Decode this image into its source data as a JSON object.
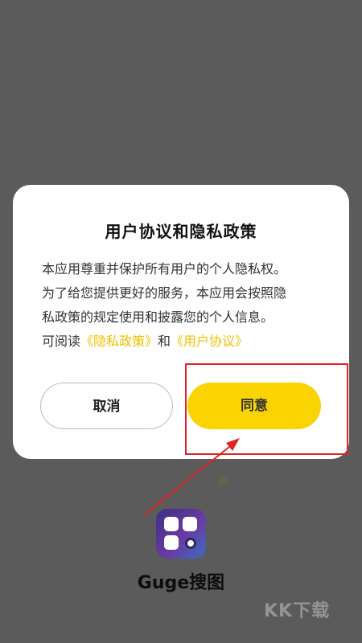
{
  "dialog": {
    "title": "用户协议和隐私政策",
    "body_line_1": "本应用尊重并保护所有用户的个人隐私权。",
    "body_line_2": "为了给您提供更好的服务，本应用会按照隐",
    "body_line_3": "私政策的规定使用和披露您的个人信息。",
    "read_prefix": "可阅读",
    "privacy_link": "《隐私政策》",
    "and_text": "和",
    "agreement_link": "《用户协议》",
    "cancel_label": "取消",
    "agree_label": "同意"
  },
  "app": {
    "name": "Guge搜图"
  },
  "watermark": {
    "text": "KK下载"
  },
  "colors": {
    "overlay": "#5b5b5b",
    "accent": "#f9d400",
    "link": "#f0c000",
    "annotation": "#e32323"
  },
  "icons": {
    "app_icon": "grid-search-icon"
  }
}
